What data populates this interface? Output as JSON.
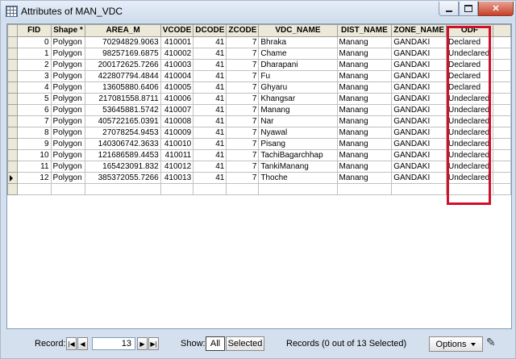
{
  "window": {
    "title": "Attributes of MAN_VDC"
  },
  "table": {
    "columns": [
      "FID",
      "Shape *",
      "AREA_M",
      "VCODE",
      "DCODE",
      "ZCODE",
      "VDC_NAME",
      "DIST_NAME",
      "ZONE_NAME",
      "ODF"
    ],
    "rows": [
      [
        "0",
        "Polygon",
        "70294829.9063",
        "410001",
        "41",
        "7",
        "Bhraka",
        "Manang",
        "GANDAKI",
        "Declared"
      ],
      [
        "1",
        "Polygon",
        "98257169.6875",
        "410002",
        "41",
        "7",
        "Chame",
        "Manang",
        "GANDAKI",
        "Undeclared"
      ],
      [
        "2",
        "Polygon",
        "200172625.7266",
        "410003",
        "41",
        "7",
        "Dharapani",
        "Manang",
        "GANDAKI",
        "Declared"
      ],
      [
        "3",
        "Polygon",
        "422807794.4844",
        "410004",
        "41",
        "7",
        "Fu",
        "Manang",
        "GANDAKI",
        "Declared"
      ],
      [
        "4",
        "Polygon",
        "13605880.6406",
        "410005",
        "41",
        "7",
        "Ghyaru",
        "Manang",
        "GANDAKI",
        "Declared"
      ],
      [
        "5",
        "Polygon",
        "217081558.8711",
        "410006",
        "41",
        "7",
        "Khangsar",
        "Manang",
        "GANDAKI",
        "Undeclared"
      ],
      [
        "6",
        "Polygon",
        "53645881.5742",
        "410007",
        "41",
        "7",
        "Manang",
        "Manang",
        "GANDAKI",
        "Undeclared"
      ],
      [
        "7",
        "Polygon",
        "405722165.0391",
        "410008",
        "41",
        "7",
        "Nar",
        "Manang",
        "GANDAKI",
        "Undeclared"
      ],
      [
        "8",
        "Polygon",
        "27078254.9453",
        "410009",
        "41",
        "7",
        "Nyawal",
        "Manang",
        "GANDAKI",
        "Undeclared"
      ],
      [
        "9",
        "Polygon",
        "140306742.3633",
        "410010",
        "41",
        "7",
        "Pisang",
        "Manang",
        "GANDAKI",
        "Undeclared"
      ],
      [
        "10",
        "Polygon",
        "121686589.4453",
        "410011",
        "41",
        "7",
        "TachiBagarchhap",
        "Manang",
        "GANDAKI",
        "Undeclared"
      ],
      [
        "11",
        "Polygon",
        "165423091.832",
        "410012",
        "41",
        "7",
        "TankiManang",
        "Manang",
        "GANDAKI",
        "Undeclared"
      ],
      [
        "12",
        "Polygon",
        "385372055.7266",
        "410013",
        "41",
        "7",
        "Thoche",
        "Manang",
        "GANDAKI",
        "Undeclared"
      ]
    ],
    "current_row_index": 12
  },
  "status": {
    "record_label": "Record:",
    "record_value": "13",
    "show_label": "Show:",
    "show_all": "All",
    "show_selected": "Selected",
    "records_text": "Records (0 out of 13 Selected)",
    "options_label": "Options"
  },
  "icons": {
    "title": "table-grid-icon",
    "first": "first-record-icon",
    "prev": "prev-record-icon",
    "next": "next-record-icon",
    "last": "last-record-icon",
    "pen": "pencil-icon"
  },
  "colors": {
    "highlight": "#d0102a",
    "header_bg": "#ece9d8",
    "frame_bg": "#d4e0ee"
  }
}
